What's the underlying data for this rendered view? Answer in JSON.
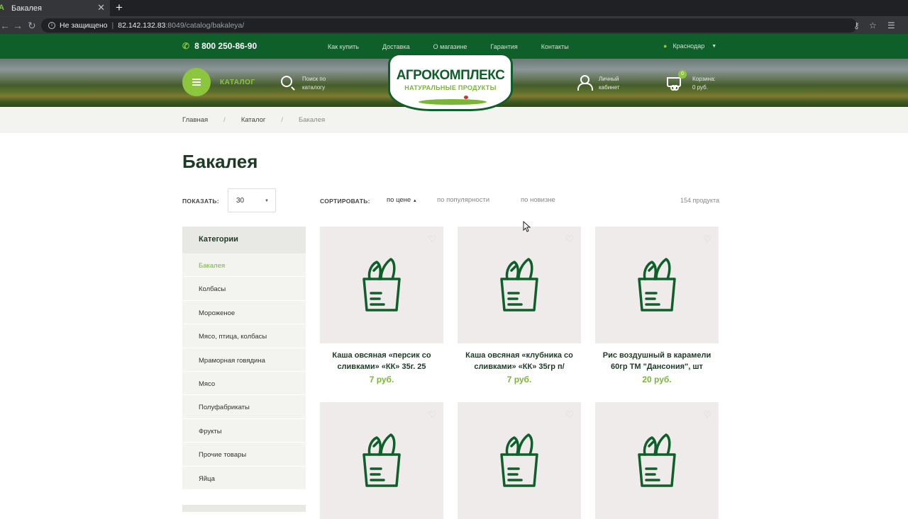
{
  "browser": {
    "tab_title": "Бакалея",
    "tab_close": "✕",
    "new_tab": "+",
    "not_secure": "Не защищено",
    "url_host": "82.142.132.83",
    "url_rest": ":8049/catalog/bakaleya/"
  },
  "topbar": {
    "phone": "8 800 250-86-90",
    "nav": [
      "Как купить",
      "Доставка",
      "О магазине",
      "Гарантия",
      "Контакты"
    ],
    "city": "Краснодар"
  },
  "header": {
    "catalog_label": "КАТАЛОГ",
    "search_label": "Поиск по каталогу",
    "logo_title": "АГРОКОМПЛЕКС",
    "logo_subtitle": "НАТУРАЛЬНЫЕ ПРОДУКТЫ",
    "account_label": "Личный кабинет",
    "cart_count": "0",
    "cart_label": "Корзина:",
    "cart_total": "0 руб."
  },
  "breadcrumbs": [
    "Главная",
    "Каталог",
    "Бакалея"
  ],
  "page": {
    "title": "Бакалея",
    "show_label": "ПОКАЗАТЬ:",
    "show_value": "30",
    "sort_label": "СОРТИРОВАТЬ:",
    "sort_options": [
      "по цене",
      "по популярности",
      "по новизне"
    ],
    "count": "154 продукта"
  },
  "sidebar": {
    "heading": "Категории",
    "items": [
      "Бакалея",
      "Колбасы",
      "Мороженое",
      "Мясо, птица, колбасы",
      "Мраморная говядина",
      "Мясо",
      "Полуфабрикаты",
      "Фрукты",
      "Прочие товары",
      "Яйца"
    ]
  },
  "products": [
    {
      "name": "Каша овсяная «персик со сливками» «КК» 35г. 25",
      "price": "7 руб."
    },
    {
      "name": "Каша овсяная «клубника со сливками» «КК» 35гр п/",
      "price": "7 руб."
    },
    {
      "name": "Рис воздушный в карамели 60гр ТМ \"Дансония\", шт",
      "price": "20 руб."
    },
    {
      "name": "",
      "price": ""
    },
    {
      "name": "",
      "price": ""
    },
    {
      "name": "",
      "price": ""
    }
  ],
  "colors": {
    "brand_green": "#0e5f2a",
    "accent_green": "#8cc63f",
    "price_green": "#7ab536"
  }
}
